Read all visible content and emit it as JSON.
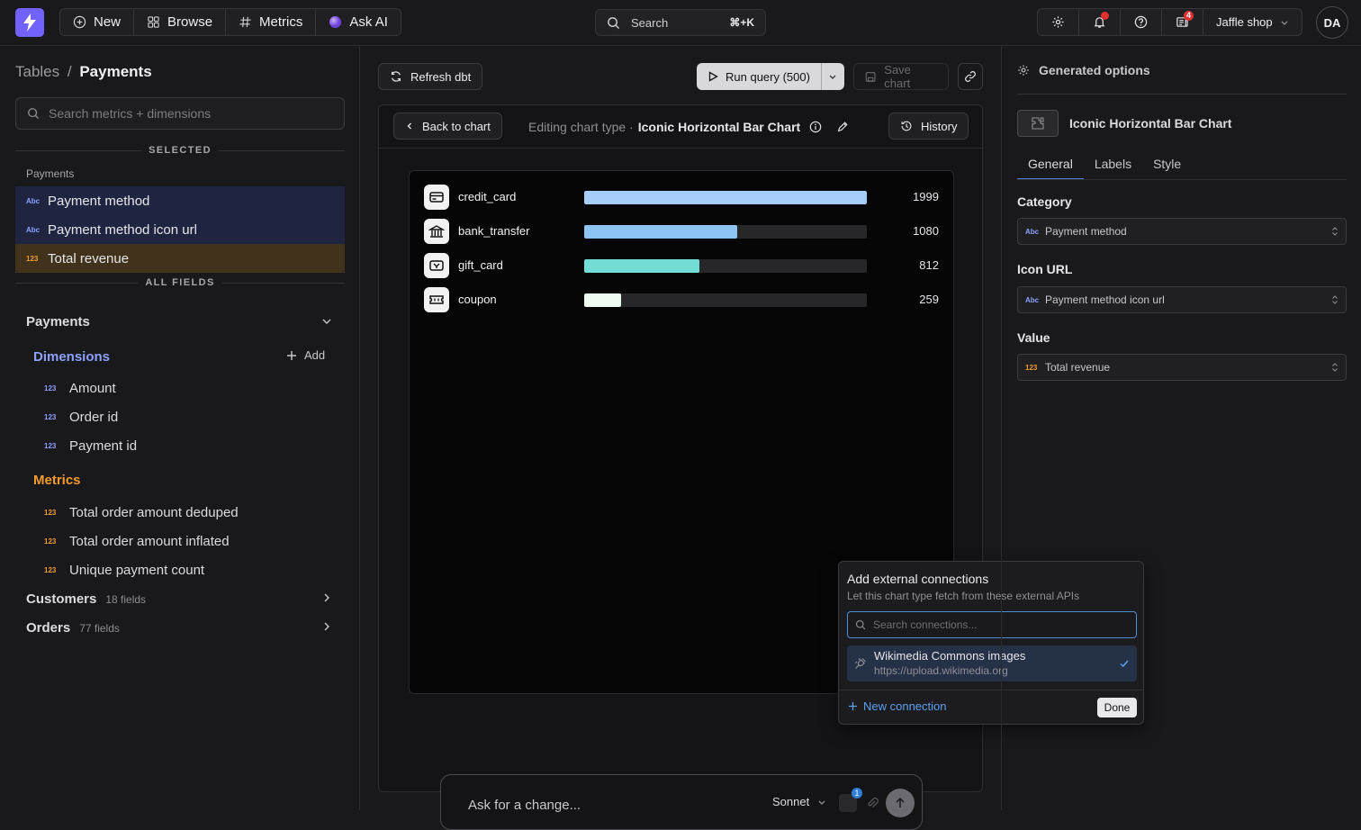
{
  "topbar": {
    "nav": [
      {
        "label": "New",
        "icon": "plus-circle-icon"
      },
      {
        "label": "Browse",
        "icon": "grid-icon"
      },
      {
        "label": "Metrics",
        "icon": "hash-icon"
      },
      {
        "label": "Ask AI",
        "icon": "ai-orb-icon"
      }
    ],
    "search_label": "Search",
    "search_shortcut": "⌘+K",
    "notifications_badge": "4",
    "project": "Jaffle shop",
    "avatar_initials": "DA"
  },
  "sidebar": {
    "breadcrumb_root": "Tables",
    "breadcrumb_sep": "/",
    "breadcrumb_current": "Payments",
    "search_placeholder": "Search metrics + dimensions",
    "selected_label": "SELECTED",
    "selected_group": "Payments",
    "selected_items": [
      {
        "tag": "Abc",
        "label": "Payment method"
      },
      {
        "tag": "Abc",
        "label": "Payment method icon url"
      },
      {
        "tag": "123",
        "label": "Total revenue"
      }
    ],
    "all_fields_label": "ALL FIELDS",
    "table_name": "Payments",
    "dimensions_label": "Dimensions",
    "add_label": "Add",
    "dimensions": [
      "Amount",
      "Order id",
      "Payment id"
    ],
    "metrics_label": "Metrics",
    "metrics": [
      "Total order amount deduped",
      "Total order amount inflated",
      "Unique payment count"
    ],
    "other_tables": [
      {
        "name": "Customers",
        "count": "18 fields"
      },
      {
        "name": "Orders",
        "count": "77 fields"
      }
    ]
  },
  "toolbar": {
    "refresh_label": "Refresh dbt",
    "run_label": "Run query (500)",
    "save_label": "Save chart"
  },
  "editor": {
    "back_label": "Back to chart",
    "editing_prefix": "Editing chart type ·",
    "chart_type_name": "Iconic Horizontal Bar Chart",
    "history_label": "History",
    "prompt_placeholder": "Ask for a change...",
    "model": "Sonnet",
    "context_count": "1"
  },
  "chart_data": {
    "type": "bar",
    "orientation": "horizontal",
    "categories": [
      "credit_card",
      "bank_transfer",
      "gift_card",
      "coupon"
    ],
    "values": [
      1999,
      1080,
      812,
      259
    ],
    "icons": [
      "credit-card-icon",
      "bank-icon",
      "gift-card-icon",
      "coupon-icon"
    ],
    "colors": [
      "#a7cdfb",
      "#8ec4f4",
      "#72dcd5",
      "#eefbf0"
    ],
    "xlim": [
      0,
      1999
    ]
  },
  "popover": {
    "title": "Add external connections",
    "subtitle": "Let this chart type fetch from these external APIs",
    "search_placeholder": "Search connections...",
    "connection_name": "Wikimedia Commons images",
    "connection_url": "https://upload.wikimedia.org",
    "new_connection_label": "New connection",
    "done_label": "Done"
  },
  "options": {
    "header": "Generated options",
    "chart_type_name": "Iconic Horizontal Bar Chart",
    "tabs": [
      "General",
      "Labels",
      "Style"
    ],
    "fields": [
      {
        "label": "Category",
        "tag": "Abc",
        "value": "Payment method"
      },
      {
        "label": "Icon URL",
        "tag": "Abc",
        "value": "Payment method icon url"
      },
      {
        "label": "Value",
        "tag": "123",
        "value": "Total revenue"
      }
    ]
  },
  "colors": {
    "brand": "#7262ff",
    "dimension": "#8ea1ff",
    "metric": "#f39b2c",
    "accent_blue": "#4c7ed9"
  }
}
